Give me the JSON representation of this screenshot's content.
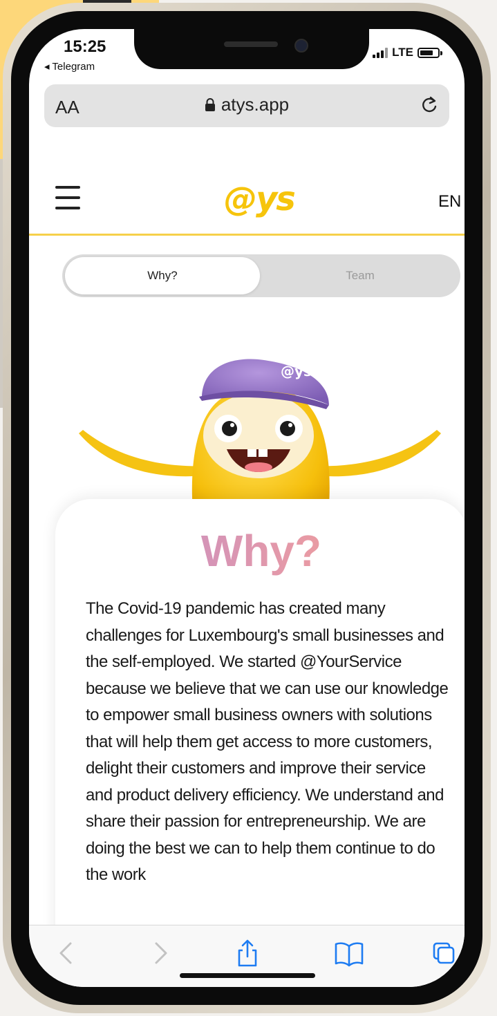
{
  "status_bar": {
    "time": "15:25",
    "back_app": "◂ Telegram",
    "network": "LTE"
  },
  "browser": {
    "text_size_label": "AA",
    "url": "atys.app"
  },
  "site_header": {
    "logo": "@ys",
    "language": "EN"
  },
  "segmented_tabs": [
    {
      "label": "Why?",
      "active": true
    },
    {
      "label": "Team",
      "active": false
    }
  ],
  "card": {
    "title": "Why?",
    "body": "The Covid-19 pandemic has created many challenges for Luxembourg's small businesses and the self-employed. We started @YourService because we believe that we can use our knowledge to empower small business owners with solutions that will help them get access to more customers, delight their customers and improve their service and product delivery efficiency. We understand and share their passion for entrepreneurship. We are doing the best we can to help them continue to do the work"
  },
  "toolbar_icons": [
    "back-icon",
    "forward-icon",
    "share-icon",
    "bookmarks-icon",
    "tabs-icon"
  ],
  "colors": {
    "brand_yellow": "#f6c40c",
    "title_gradient_start": "#b98ad0",
    "title_gradient_end": "#f2a789",
    "ios_blue": "#1e7cf2"
  }
}
